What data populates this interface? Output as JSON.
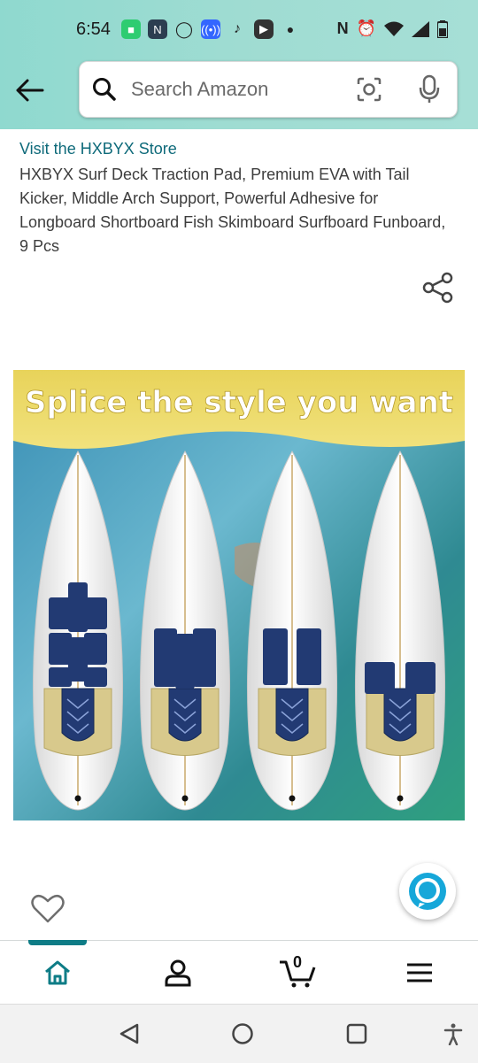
{
  "status_bar": {
    "time": "6:54",
    "icons": [
      "messages-icon",
      "n-app-icon",
      "circle-app-icon",
      "podcast-icon",
      "tiktok-icon",
      "youtube-icon",
      "dot-icon"
    ],
    "right_icons": [
      "nfc-icon",
      "alarm-icon",
      "wifi-icon",
      "signal-icon",
      "battery-icon"
    ]
  },
  "header": {
    "search": {
      "placeholder": "Search Amazon"
    }
  },
  "product": {
    "store_link": "Visit the HXBYX Store",
    "title": "HXBYX Surf Deck Traction Pad, Premium EVA with Tail Kicker, Middle Arch Support, Powerful Adhesive for Longboard Shortboard Fish Skimboard Surfboard Funboard, 9 Pcs",
    "image_banner_text": "Splice the style you want"
  },
  "bottom_nav": {
    "items": [
      {
        "name": "home",
        "icon": "home-icon",
        "active": true
      },
      {
        "name": "account",
        "icon": "person-icon",
        "active": false
      },
      {
        "name": "cart",
        "icon": "cart-icon",
        "active": false
      },
      {
        "name": "menu",
        "icon": "menu-icon",
        "active": false
      }
    ],
    "cart_count": "0"
  },
  "colors": {
    "header_bg": "#9fdcd2",
    "link": "#0e6a7a",
    "active_nav": "#0e7c86",
    "pad_navy": "#223a73",
    "pad_tan": "#d8c98c"
  }
}
